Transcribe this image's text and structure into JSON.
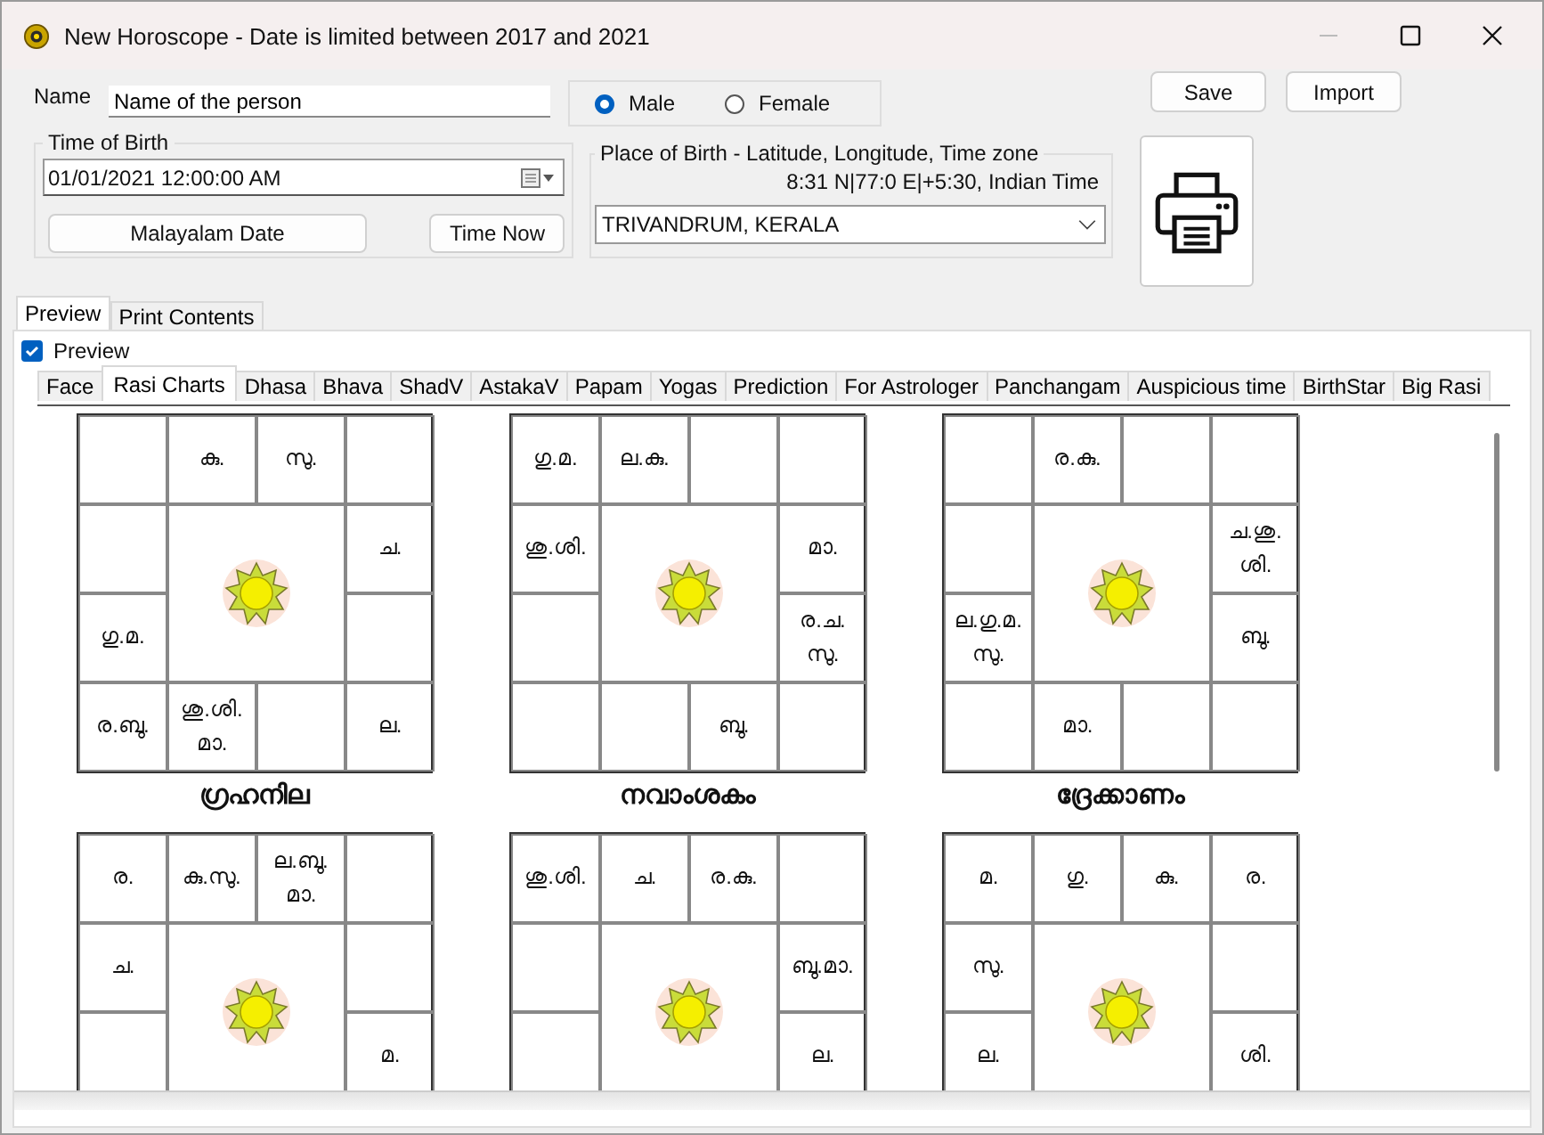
{
  "window": {
    "title": "New Horoscope - Date is limited between 2017 and 2021"
  },
  "form": {
    "name_label": "Name",
    "name_value": "Name of the person",
    "gender": [
      {
        "label": "Male",
        "selected": true
      },
      {
        "label": "Female",
        "selected": false
      }
    ],
    "buttons": [
      "Save",
      "Import"
    ],
    "time_of_birth": {
      "legend": "Time of Birth",
      "value": "01/01/2021  12:00:00 AM",
      "buttons": [
        "Malayalam Date",
        "Time Now"
      ]
    },
    "place_of_birth": {
      "legend": "Place of Birth - Latitude, Longitude, Time zone",
      "coordinates": "8:31 N|77:0 E|+5:30, Indian Time",
      "value": "TRIVANDRUM, KERALA"
    }
  },
  "outer_tabs": [
    {
      "label": "Preview",
      "selected": true
    },
    {
      "label": "Print Contents",
      "selected": false
    }
  ],
  "preview_checkbox": {
    "label": "Preview",
    "checked": true
  },
  "tabs": [
    {
      "label": "Face",
      "selected": false
    },
    {
      "label": "Rasi Charts",
      "selected": true
    },
    {
      "label": "Dhasa",
      "selected": false
    },
    {
      "label": "Bhava",
      "selected": false
    },
    {
      "label": "ShadV",
      "selected": false
    },
    {
      "label": "AstakaV",
      "selected": false
    },
    {
      "label": "Papam",
      "selected": false
    },
    {
      "label": "Yogas",
      "selected": false
    },
    {
      "label": "Prediction",
      "selected": false
    },
    {
      "label": "For Astrologer",
      "selected": false
    },
    {
      "label": "Panchangam",
      "selected": false
    },
    {
      "label": "Auspicious time",
      "selected": false
    },
    {
      "label": "BirthStar",
      "selected": false
    },
    {
      "label": "Big Rasi",
      "selected": false
    }
  ],
  "charts": [
    {
      "title": "ഗ്രഹനില",
      "rows": [
        [
          null,
          "കു.",
          "സു.",
          null
        ],
        [
          null,
          null,
          null,
          "ച."
        ],
        [
          "ഗു.മ.",
          null,
          null,
          null
        ],
        [
          "ര.ബു.",
          "ശു.ശി. മാ.",
          null,
          "ല."
        ]
      ]
    },
    {
      "title": "നവാംശകം",
      "rows": [
        [
          "ഗു.മ.",
          "ല.കു.",
          null,
          null
        ],
        [
          "ശു.ശി.",
          null,
          null,
          "മാ."
        ],
        [
          null,
          null,
          null,
          "ര.ച. സു."
        ],
        [
          null,
          null,
          "ബു.",
          null
        ]
      ]
    },
    {
      "title": "ദ്രേക്കാണം",
      "rows": [
        [
          null,
          "ര.കു.",
          null,
          null
        ],
        [
          null,
          null,
          null,
          "ച.ശു. ശി."
        ],
        [
          "ല.ഗു.മ. സു.",
          null,
          null,
          "ബു."
        ],
        [
          null,
          "മാ.",
          null,
          null
        ]
      ]
    },
    {
      "rows": [
        [
          "ര.",
          "കു.സു.",
          "ല.ബു. മാ.",
          null
        ],
        [
          "ച.",
          null,
          null,
          null
        ],
        [
          null,
          null,
          null,
          "മ."
        ]
      ]
    },
    {
      "rows": [
        [
          "ശു.ശി.",
          "ച.",
          "ര.കു.",
          null
        ],
        [
          null,
          null,
          null,
          "ബു.മാ."
        ],
        [
          null,
          null,
          null,
          "ല."
        ]
      ]
    },
    {
      "rows": [
        [
          "മ.",
          "ഗു.",
          "കു.",
          "ര."
        ],
        [
          "സു.",
          null,
          null,
          null
        ],
        [
          "ല.",
          null,
          null,
          "ശി."
        ]
      ]
    }
  ]
}
